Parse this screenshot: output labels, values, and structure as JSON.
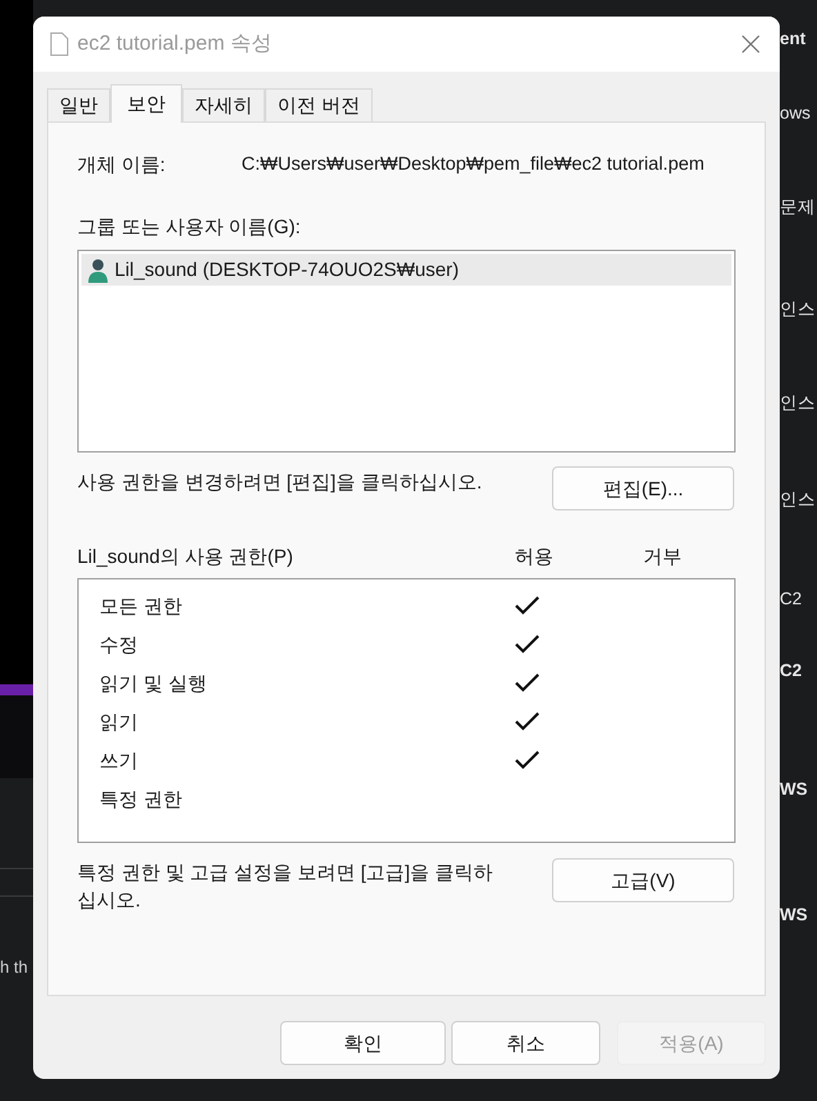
{
  "background": {
    "left_items": [
      {
        "text": "h th"
      }
    ],
    "right_items": [
      {
        "text": "ent",
        "bold": true
      },
      {
        "text": "ows",
        "bold": false
      },
      {
        "text": "문제",
        "bold": false
      },
      {
        "text": "인스",
        "bold": false
      },
      {
        "text": "인스",
        "bold": false
      },
      {
        "text": "인스",
        "bold": false
      },
      {
        "text": "C2",
        "bold": false
      },
      {
        "text": "C2",
        "bold": true
      },
      {
        "text": "WS",
        "bold": true
      },
      {
        "text": "WS",
        "bold": true
      }
    ]
  },
  "window": {
    "title": "ec2 tutorial.pem 속성"
  },
  "tabs": [
    {
      "label": "일반",
      "selected": false
    },
    {
      "label": "보안",
      "selected": true
    },
    {
      "label": "자세히",
      "selected": false
    },
    {
      "label": "이전 버전",
      "selected": false
    }
  ],
  "object_name": {
    "label": "개체 이름:",
    "value": "C:₩Users₩user₩Desktop₩pem_file₩ec2 tutorial.pem"
  },
  "users": {
    "label": "그룹 또는 사용자 이름(G):",
    "items": [
      {
        "name": "Lil_sound (DESKTOP-74OUO2S₩user)",
        "selected": true
      }
    ]
  },
  "edit_hint": {
    "text": "사용 권한을 변경하려면 [편집]을 클릭하십시오.",
    "button": {
      "label": "편집(E)...",
      "disabled": false
    }
  },
  "permissions": {
    "label": "Lil_sound의 사용 권한(P)",
    "allow_header": "허용",
    "deny_header": "거부",
    "rows": [
      {
        "name": "모든 권한",
        "allow": true,
        "deny": false
      },
      {
        "name": "수정",
        "allow": true,
        "deny": false
      },
      {
        "name": "읽기 및 실행",
        "allow": true,
        "deny": false
      },
      {
        "name": "읽기",
        "allow": true,
        "deny": false
      },
      {
        "name": "쓰기",
        "allow": true,
        "deny": false
      },
      {
        "name": "특정 권한",
        "allow": false,
        "deny": false
      }
    ]
  },
  "advanced_hint": {
    "text": "특정 권한 및 고급 설정을 보려면 [고급]을 클릭하십시오.",
    "button": {
      "label": "고급(V)",
      "disabled": false
    }
  },
  "footer_buttons": [
    {
      "label": "확인",
      "disabled": false
    },
    {
      "label": "취소",
      "disabled": false
    },
    {
      "label": "적용(A)",
      "disabled": true
    }
  ]
}
